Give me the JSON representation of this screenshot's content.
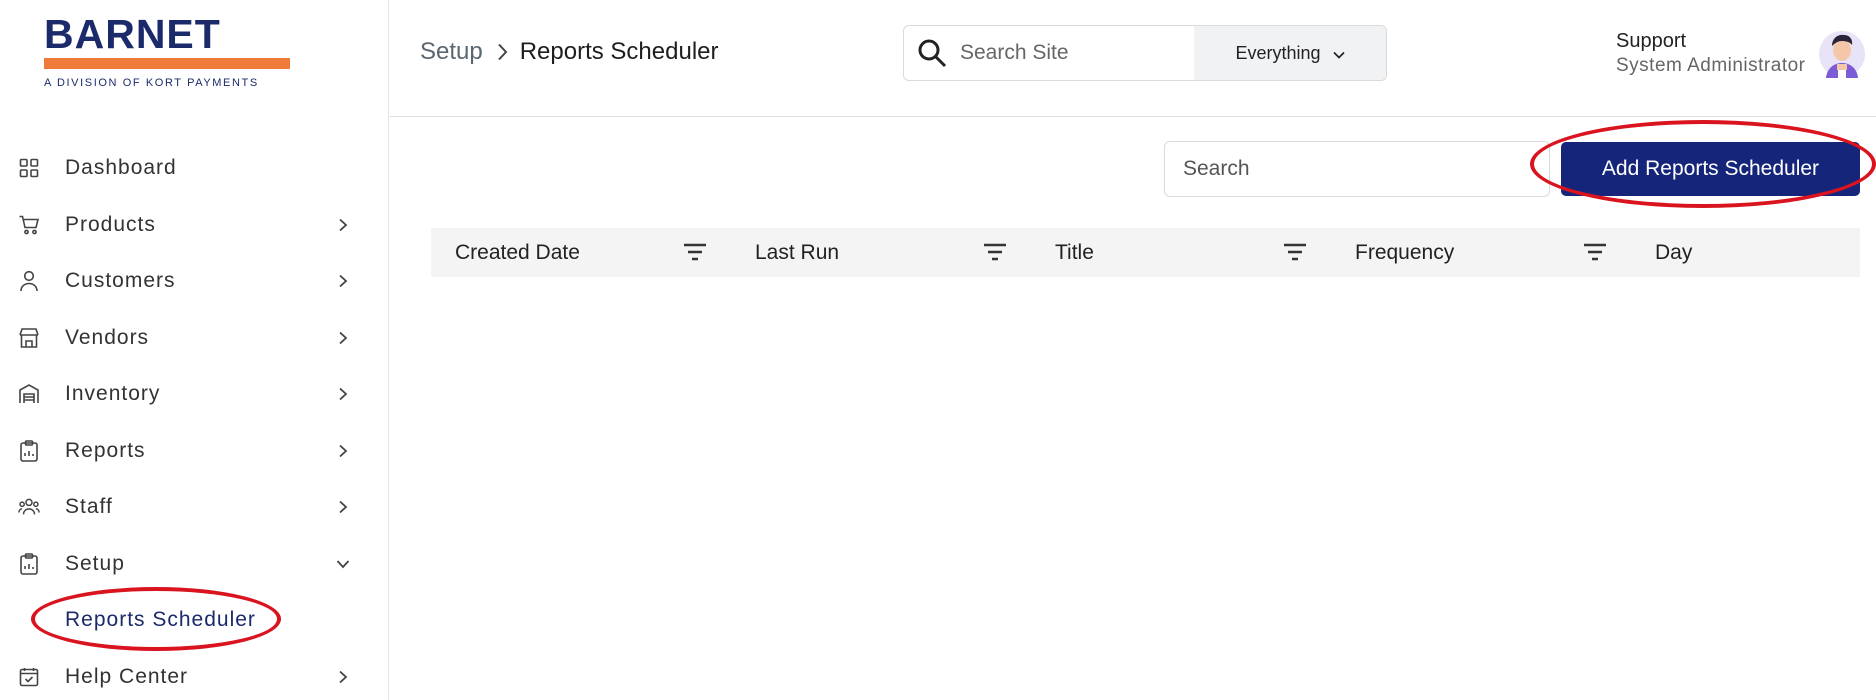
{
  "logo": {
    "name": "BARNET",
    "tagline": "A DIVISION OF KORT PAYMENTS"
  },
  "sidebar": {
    "items": [
      {
        "label": "Dashboard",
        "icon": "grid-icon",
        "chevron": ""
      },
      {
        "label": "Products",
        "icon": "cart-icon",
        "chevron": "right"
      },
      {
        "label": "Customers",
        "icon": "person-icon",
        "chevron": "right"
      },
      {
        "label": "Vendors",
        "icon": "store-icon",
        "chevron": "right"
      },
      {
        "label": "Inventory",
        "icon": "warehouse-icon",
        "chevron": "right"
      },
      {
        "label": "Reports",
        "icon": "clipboard-icon",
        "chevron": "right"
      },
      {
        "label": "Staff",
        "icon": "people-icon",
        "chevron": "right"
      },
      {
        "label": "Setup",
        "icon": "clipboard-icon",
        "chevron": "down"
      }
    ],
    "sub_item": {
      "label": "Reports Scheduler"
    },
    "help": {
      "label": "Help Center",
      "icon": "calendar-check-icon",
      "chevron": "right"
    }
  },
  "header": {
    "breadcrumb_parent": "Setup",
    "breadcrumb_current": "Reports Scheduler",
    "site_search_placeholder": "Search Site",
    "scope_label": "Everything",
    "user_name": "Support",
    "user_role": "System Administrator"
  },
  "toolbar": {
    "search_placeholder": "Search",
    "add_button_label": "Add Reports Scheduler"
  },
  "table": {
    "columns": [
      "Created Date",
      "Last Run",
      "Title",
      "Frequency",
      "Day"
    ]
  },
  "colors": {
    "brand_navy": "#15267a",
    "brand_orange": "#f07a3a",
    "annotation_red": "#d9141f"
  }
}
